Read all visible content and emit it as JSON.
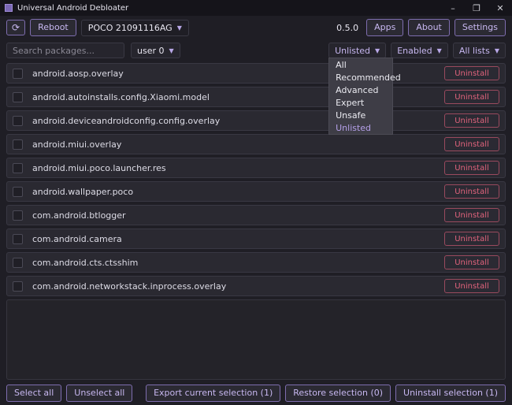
{
  "window": {
    "title": "Universal Android Debloater",
    "minimize": "–",
    "maximize": "❐",
    "close": "✕"
  },
  "toolbar": {
    "refresh_icon": "⟳",
    "reboot_label": "Reboot",
    "device_value": "POCO 21091116AG",
    "version": "0.5.0",
    "apps_label": "Apps",
    "about_label": "About",
    "settings_label": "Settings"
  },
  "filters": {
    "search_placeholder": "Search packages...",
    "user_value": "user 0",
    "list_value": "Unlisted",
    "state_value": "Enabled",
    "lists_value": "All lists",
    "list_options": [
      "All",
      "Recommended",
      "Advanced",
      "Expert",
      "Unsafe",
      "Unlisted"
    ],
    "list_selected": "Unlisted"
  },
  "package_list": {
    "action_label": "Uninstall",
    "packages": [
      "android.aosp.overlay",
      "android.autoinstalls.config.Xiaomi.model",
      "android.deviceandroidconfig.config.overlay",
      "android.miui.overlay",
      "android.miui.poco.launcher.res",
      "android.wallpaper.poco",
      "com.android.btlogger",
      "com.android.camera",
      "com.android.cts.ctsshim",
      "com.android.networkstack.inprocess.overlay"
    ]
  },
  "footer": {
    "select_all": "Select all",
    "unselect_all": "Unselect all",
    "export_label": "Export current selection (1)",
    "restore_label": "Restore selection (0)",
    "uninstall_label": "Uninstall selection (1)"
  }
}
